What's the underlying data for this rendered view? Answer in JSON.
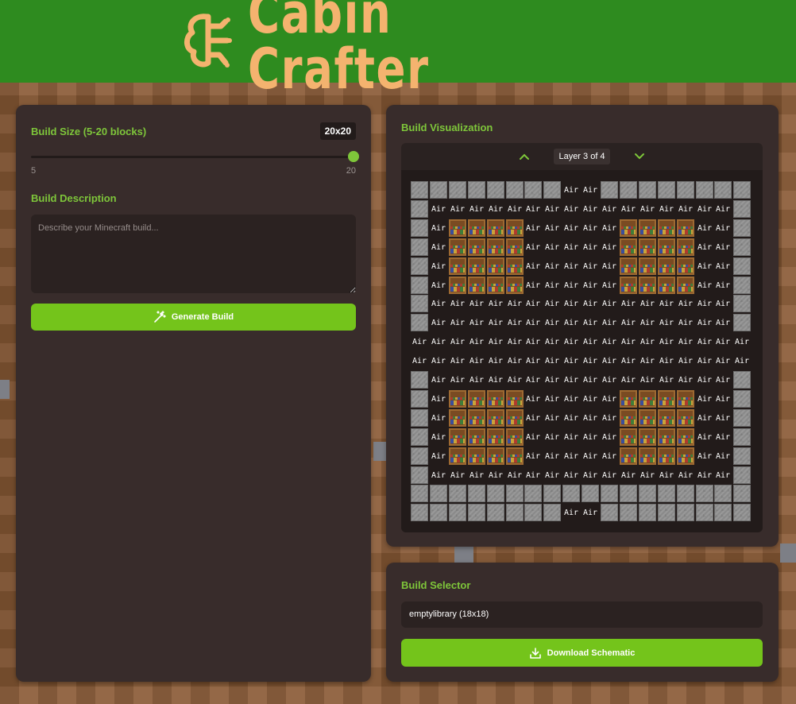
{
  "header": {
    "title": "Cabin Crafter",
    "logo_icon": "brain-circuit-icon",
    "bg_color": "#2e8b1f",
    "title_color": "#f4b36f"
  },
  "build_size": {
    "label": "Build Size (5-20 blocks)",
    "badge": "20x20",
    "min_label": "5",
    "max_label": "20",
    "value": 20,
    "min": 5,
    "max": 20
  },
  "description": {
    "label": "Build Description",
    "placeholder": "Describe your Minecraft build..."
  },
  "generate_button": {
    "label": "Generate Build",
    "icon": "magic-wand-icon"
  },
  "visualization": {
    "title": "Build Visualization",
    "layer_label": "Layer 3 of 4",
    "up_icon": "chevron-up-icon",
    "down_icon": "chevron-down-icon",
    "air_text": "Air",
    "legend": {
      "S": "stone",
      "B": "bookshelf",
      "A": "Air"
    },
    "grid": [
      "SSSSSSSSAASSSSSSSS",
      "SAAAAAAAAAAAAAAAAS",
      "SABBBBAAAAABBBBAAS",
      "SABBBBAAAAABBBBAAS",
      "SABBBBAAAAABBBBAAS",
      "SABBBBAAAAABBBBAAS",
      "SAAAAAAAAAAAAAAAAS",
      "SAAAAAAAAAAAAAAAAS",
      "AAAAAAAAAAAAAAAAAA",
      "AAAAAAAAAAAAAAAAAA",
      "SAAAAAAAAAAAAAAAAS",
      "SABBBBAAAAABBBBAAS",
      "SABBBBAAAAABBBBAAS",
      "SABBBBAAAAABBBBAAS",
      "SABBBBAAAAABBBBAAS",
      "SAAAAAAAAAAAAAAAAS",
      "SSSSSSSSSSSSSSSSSS",
      "SSSSSSSSAASSSSSSSS"
    ]
  },
  "selector": {
    "title": "Build Selector",
    "value": "emptylibrary (18x18)"
  },
  "download_button": {
    "label": "Download Schematic",
    "icon": "download-icon"
  },
  "colors": {
    "accent": "#74c41b",
    "label_green": "#7ec63a",
    "panel": "#382c2b"
  }
}
